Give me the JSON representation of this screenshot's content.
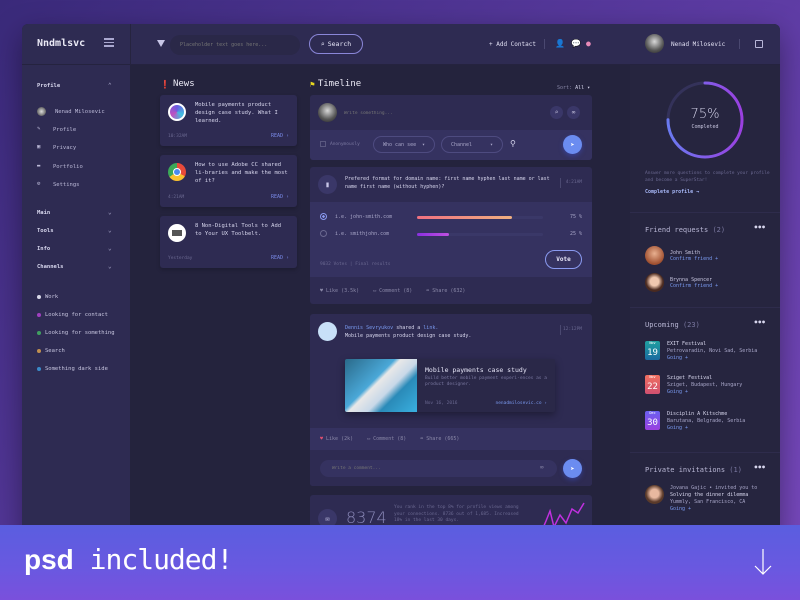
{
  "header": {
    "brand": "Nndmlsvc",
    "search_placeholder": "Placeholder text goes here...",
    "search_button": "Search",
    "add_contact": "+ Add Contact",
    "user_name": "Nenad Milosevic"
  },
  "sidebar": {
    "profile_heading": "Profile",
    "profile_items": [
      {
        "label": "Nenad Milosevic",
        "icon": "avatar"
      },
      {
        "label": "Profile",
        "icon": "pencil-icon"
      },
      {
        "label": "Privacy",
        "icon": "lock-icon"
      },
      {
        "label": "Portfolio",
        "icon": "folder-icon"
      },
      {
        "label": "Settings",
        "icon": "gear-icon"
      }
    ],
    "groups": [
      "Main",
      "Tools",
      "Info",
      "Channels"
    ],
    "channels": [
      {
        "label": "Work",
        "color": "#d8d8e8"
      },
      {
        "label": "Looking for contact",
        "color": "#a040c0"
      },
      {
        "label": "Looking for something",
        "color": "#40a060"
      },
      {
        "label": "Search",
        "color": "#c09050"
      },
      {
        "label": "Something dark side",
        "color": "#3a8ac8"
      }
    ]
  },
  "news": {
    "title": "News",
    "items": [
      {
        "text": "Mobile payments product design case study. What I learned.",
        "time": "10:32AM",
        "read": "READ ›"
      },
      {
        "text": "How to use Adobe CC shared li-braries and make the most of it?",
        "time": "4:21AM",
        "read": "READ ›"
      },
      {
        "text": "8 Non-Digital Tools to Add to Your UX Toolbelt.",
        "time": "Yesterday",
        "read": "READ ›"
      }
    ]
  },
  "timeline": {
    "title": "Timeline",
    "sort_label": "Sort:",
    "sort_value": "All ▾",
    "composer": {
      "placeholder": "Write something...",
      "anonymously": "Anonymously",
      "who_can_see": "Who can see",
      "channel": "Channel"
    },
    "poll": {
      "question": "Prefered format for domain name: first name hyphen last name or last name first name (without hyphen)?",
      "time": "4:21AM",
      "options": [
        {
          "label": "i.e. john-smith.com",
          "percent": 75,
          "selected": true,
          "pct_label": "75 %"
        },
        {
          "label": "i.e. smithjohn.com",
          "percent": 25,
          "selected": false,
          "pct_label": "25 %"
        }
      ],
      "footer": "9032 Votes | Final results",
      "vote_button": "Vote",
      "like": "Like",
      "like_count": "(3.5k)",
      "comment": "Comment",
      "comment_count": "(8)",
      "share": "Share",
      "share_count": "(632)"
    },
    "share_post": {
      "author": "Dennis Sevryukov",
      "action": "shared a",
      "link_word": "link.",
      "subtitle": "Mobile payments product design case study.",
      "time": "12:12PM",
      "card_title": "Mobile payments case study",
      "card_desc": "Build better mobile payment experi-ences as a product designer.",
      "card_date": "Nov 16, 2016",
      "card_link": "nenadmilosevic.co ›",
      "like": "Like",
      "like_count": "(2k)",
      "comment": "Comment",
      "comment_count": "(8)",
      "share": "Share",
      "share_count": "(665)",
      "comment_placeholder": "Write a comment..."
    },
    "stats": {
      "number": "8374",
      "text": "You rank in the top 8% for profile views among your connections. 8736 out of 1,685. Increased 18% in the last 30 days."
    }
  },
  "right": {
    "progress": {
      "percent": 75,
      "label": "75%",
      "sub": "Completed"
    },
    "progress_text": "Answer more questions to complete your profile and become a SuperStar!",
    "complete_link": "Complete profile →",
    "friend_requests": {
      "title": "Friend requests",
      "count": "(2)",
      "items": [
        {
          "name": "John Smith",
          "action": "Confirm friend +"
        },
        {
          "name": "Brynna Spencer",
          "action": "Confirm friend +"
        }
      ]
    },
    "upcoming": {
      "title": "Upcoming",
      "count": "(23)",
      "items": [
        {
          "month": "Nov",
          "day": "19",
          "name": "EXIT Festival",
          "location": "Petrovaradin, Novi Sad, Serbia",
          "status": "Going +",
          "color": "#1a8aa0"
        },
        {
          "month": "Nov",
          "day": "22",
          "name": "Sziget Festival",
          "location": "Sziget, Budapest, Hungary",
          "status": "Going +",
          "color": "#e0606a"
        },
        {
          "month": "Dec",
          "day": "30",
          "name": "Disciplin A Kitschme",
          "location": "Barutana, Belgrade, Serbia",
          "status": "Going +",
          "color": "#8a50e0"
        }
      ]
    },
    "private_invitations": {
      "title": "Private invitations",
      "count": "(1)",
      "inviter": "Jovana Gajic • invited you to",
      "event": "Solving the dinner dilemma",
      "location": "Yummly, San Francisco, CA",
      "status": "Going +"
    }
  },
  "banner": {
    "bold": "psd",
    "light": "included!"
  }
}
